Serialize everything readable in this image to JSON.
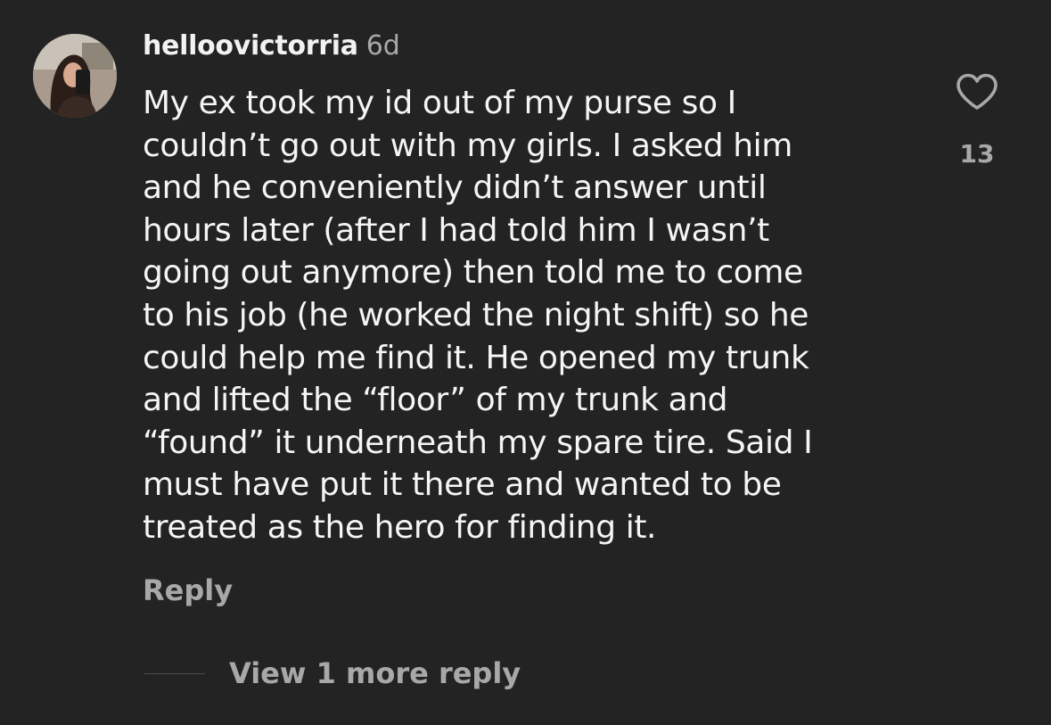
{
  "comment": {
    "username": "helloovictorria",
    "time": "6d",
    "text_lines": [
      "My ex took my id out of my purse so I",
      "couldn’t go out with my girls. I asked him",
      "and he conveniently didn’t answer until",
      "hours later (after I had told him I wasn’t",
      "going out anymore) then told me to come",
      "to his job (he worked the night shift) so he",
      "could help me find it. He opened my trunk",
      "and lifted the “floor” of my trunk and",
      "“found” it underneath my spare tire. Said I",
      "must have put it there and wanted to be",
      "treated as the hero for finding it."
    ],
    "reply_label": "Reply",
    "view_more_label": "View 1 more reply",
    "like_count": "13",
    "like_icon": "heart-outline-icon"
  },
  "colors": {
    "background": "#232323",
    "primary_text": "#f5f5f5",
    "secondary_text": "#a8a8a8"
  }
}
